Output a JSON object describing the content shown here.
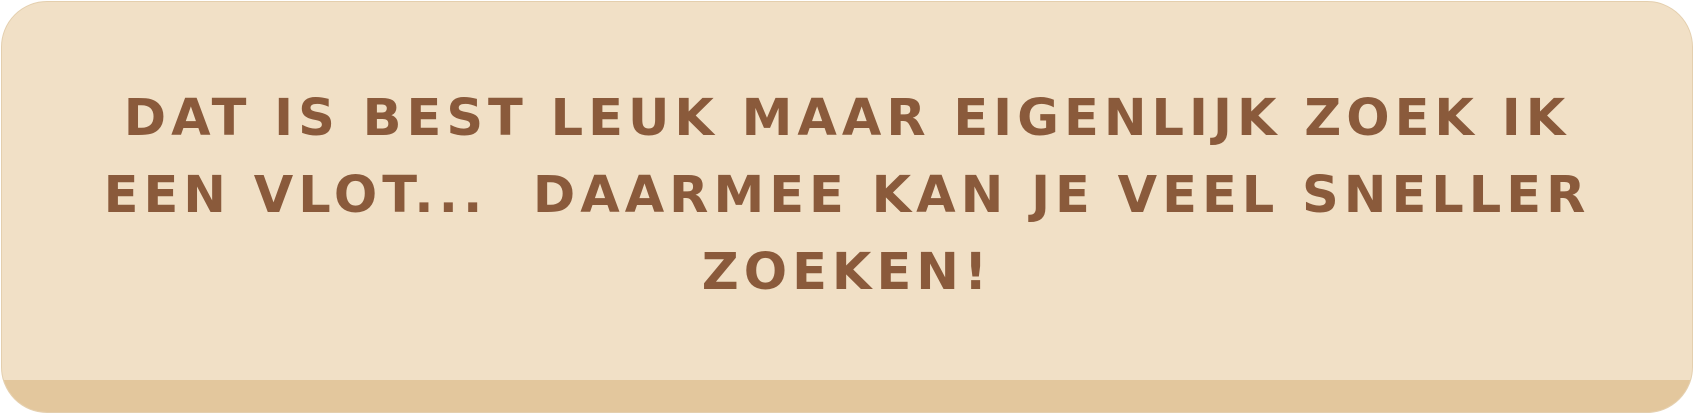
{
  "dialog": {
    "line_1": "DAT IS BEST LEUK MAAR EIGENLIJK ZOEK IK",
    "line_2": "EEN VLOT...  DAARMEE KAN JE VEEL SNELLER",
    "line_3": "ZOEKEN!"
  },
  "colors": {
    "card_background": "#f1e0c6",
    "footer_band": "#e3c79d",
    "text": "#8a5a3b"
  }
}
